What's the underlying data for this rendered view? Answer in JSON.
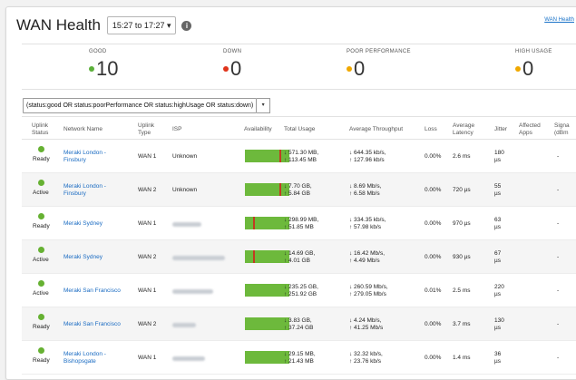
{
  "header": {
    "title": "WAN Health",
    "timerange": "15:27 to 17:27 ▾",
    "info_icon": "info-icon",
    "help_link": "WAN Health"
  },
  "stats": [
    {
      "label": "GOOD",
      "value": "10",
      "color": "#5bb03a"
    },
    {
      "label": "DOWN",
      "value": "0",
      "color": "#e0341b"
    },
    {
      "label": "POOR PERFORMANCE",
      "value": "0",
      "color": "#f0a800"
    },
    {
      "label": "HIGH USAGE",
      "value": "0",
      "color": "#f0a800"
    }
  ],
  "filter": {
    "query": "(status:good OR status:poorPerformance OR status:highUsage OR status:down)",
    "caret": "▾"
  },
  "columns": {
    "uplink_status": [
      "Uplink",
      "Status"
    ],
    "network_name": "Network Name",
    "uplink_type": [
      "Uplink",
      "Type"
    ],
    "isp": "ISP",
    "availability": "Availability",
    "total_usage": "Total Usage",
    "avg_throughput": "Average Throughput",
    "loss": "Loss",
    "avg_latency": [
      "Average",
      "Latency"
    ],
    "jitter": "Jitter",
    "affected_apps": [
      "Affected",
      "Apps"
    ],
    "signal": [
      "Signa",
      "(dBm"
    ]
  },
  "rows": [
    {
      "status": "Ready",
      "network": [
        "Meraki London -",
        "Finsbury"
      ],
      "uplink": "WAN 1",
      "isp": "Unknown",
      "avail_markers": [
        0.78
      ],
      "usage": [
        "↓ 571.30 MB,",
        "↑ 113.45 MB"
      ],
      "throughput": [
        "↓ 644.35 kb/s,",
        "↑ 127.96 kb/s"
      ],
      "loss": "0.00%",
      "latency": "2.6 ms",
      "jitter": [
        "180",
        "µs"
      ],
      "apps": "",
      "signal": "-"
    },
    {
      "status": "Active",
      "network": [
        "Meraki London -",
        "Finsbury"
      ],
      "uplink": "WAN 2",
      "isp": "Unknown",
      "avail_markers": [
        0.78
      ],
      "usage": [
        "↓ 7.70 GB,",
        "↑ 5.84 GB"
      ],
      "throughput": [
        "↓ 8.69 Mb/s,",
        "↑ 6.58 Mb/s"
      ],
      "loss": "0.00%",
      "latency": "720 µs",
      "jitter": [
        "55",
        "µs"
      ],
      "apps": "",
      "signal": "-"
    },
    {
      "status": "Ready",
      "network": [
        "Meraki Sydney"
      ],
      "uplink": "WAN 1",
      "isp": "",
      "avail_markers": [
        0.19
      ],
      "usage": [
        "↓ 298.99 MB,",
        "↑ 51.85 MB"
      ],
      "throughput": [
        "↓ 334.35 kb/s,",
        "↑ 57.98 kb/s"
      ],
      "loss": "0.00%",
      "latency": "970 µs",
      "jitter": [
        "63",
        "µs"
      ],
      "apps": "",
      "signal": "-"
    },
    {
      "status": "Active",
      "network": [
        "Meraki Sydney"
      ],
      "uplink": "WAN 2",
      "isp": "",
      "avail_markers": [
        0.19
      ],
      "usage": [
        "↓ 14.69 GB,",
        "↑ 4.01 GB"
      ],
      "throughput": [
        "↓ 16.42 Mb/s,",
        "↑ 4.49 Mb/s"
      ],
      "loss": "0.00%",
      "latency": "930 µs",
      "jitter": [
        "67",
        "µs"
      ],
      "apps": "",
      "signal": "-"
    },
    {
      "status": "Active",
      "network": [
        "Meraki San Francisco"
      ],
      "uplink": "WAN 1",
      "isp": "",
      "avail_markers": [],
      "usage": [
        "↓ 235.25 GB,",
        "↑ 251.92 GB"
      ],
      "throughput": [
        "↓ 260.59 Mb/s,",
        "↑ 279.05 Mb/s"
      ],
      "loss": "0.01%",
      "latency": "2.5 ms",
      "jitter": [
        "220",
        "µs"
      ],
      "apps": "",
      "signal": "-"
    },
    {
      "status": "Ready",
      "network": [
        "Meraki San Francisco"
      ],
      "uplink": "WAN 2",
      "isp": "",
      "avail_markers": [],
      "usage": [
        "↓ 3.83 GB,",
        "↑ 37.24 GB"
      ],
      "throughput": [
        "↓ 4.24 Mb/s,",
        "↑ 41.25 Mb/s"
      ],
      "loss": "0.00%",
      "latency": "3.7 ms",
      "jitter": [
        "130",
        "µs"
      ],
      "apps": "",
      "signal": "-"
    },
    {
      "status": "Ready",
      "network": [
        "Meraki London -",
        "Bishopsgate"
      ],
      "uplink": "WAN 1",
      "isp": "",
      "avail_markers": [],
      "usage": [
        "↓ 29.15 MB,",
        "↑ 21.43 MB"
      ],
      "throughput": [
        "↓ 32.32 kb/s,",
        "↑ 23.76 kb/s"
      ],
      "loss": "0.00%",
      "latency": "1.4 ms",
      "jitter": [
        "36",
        "µs"
      ],
      "apps": "",
      "signal": "-"
    }
  ],
  "colors": {
    "accent": "#1a6bc2",
    "status_good": "#66b132",
    "avail_bar": "#6db93c",
    "avail_marker": "#c23b22"
  }
}
